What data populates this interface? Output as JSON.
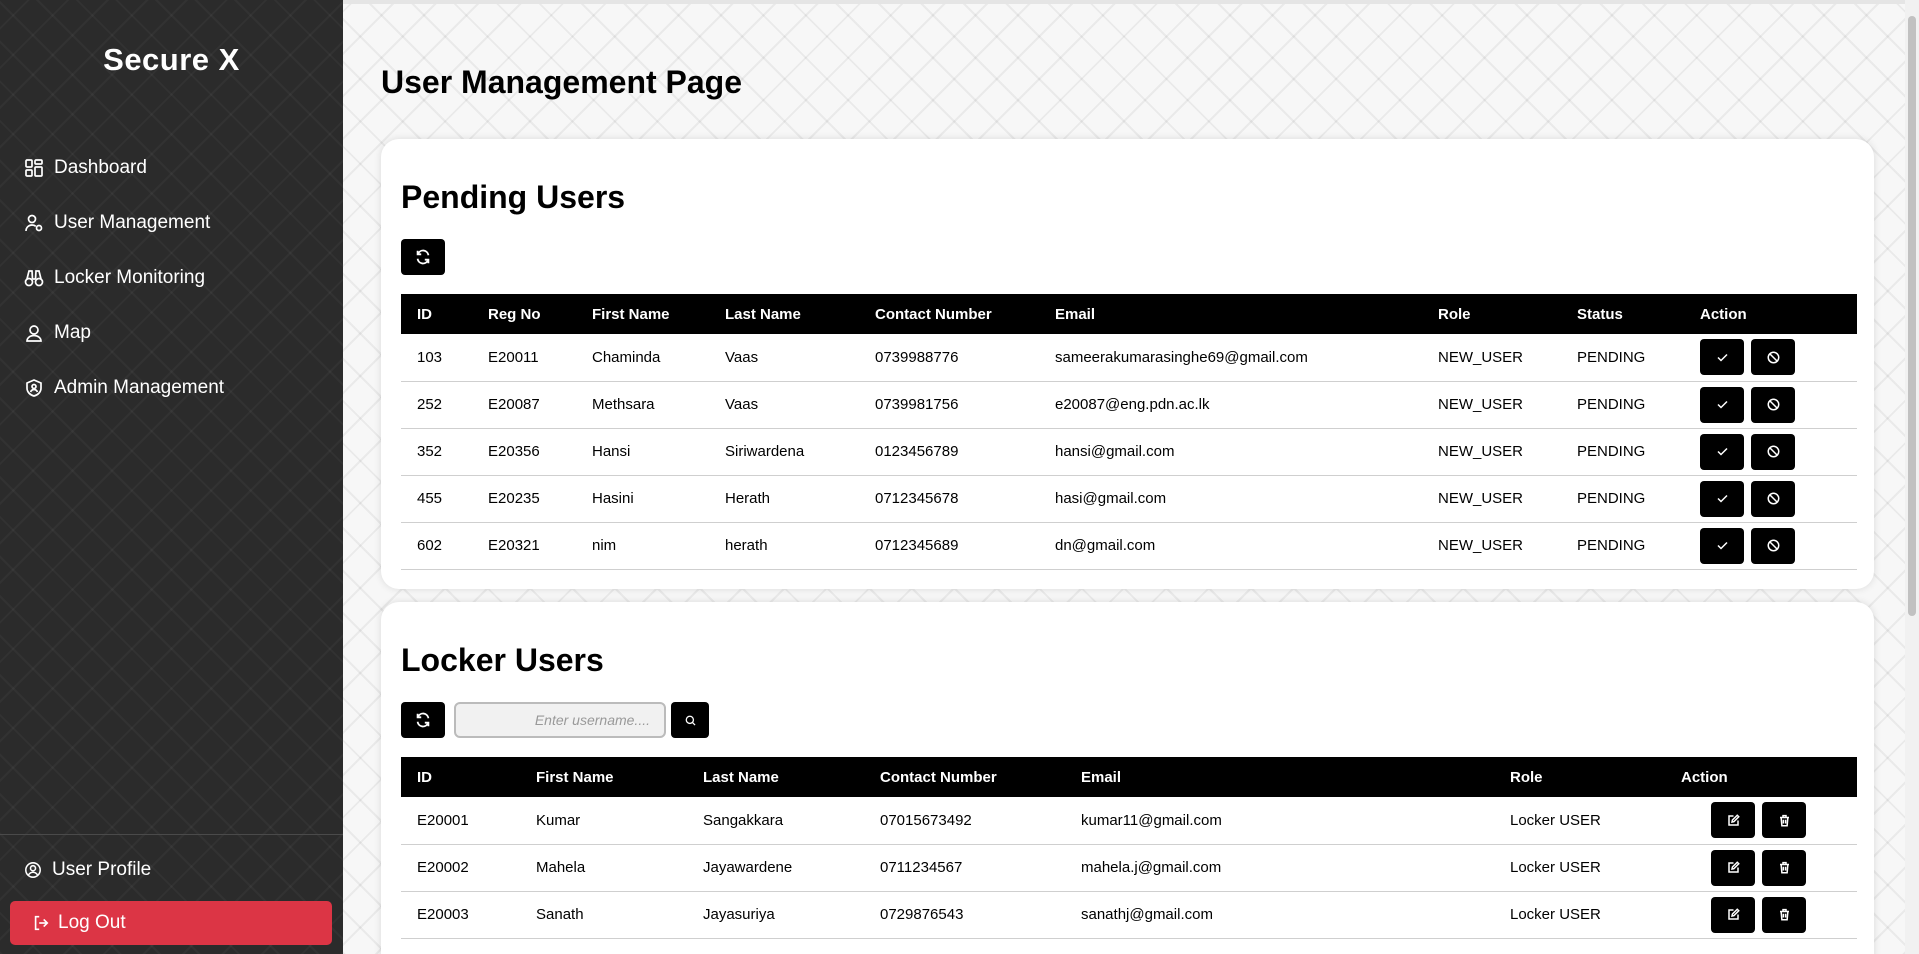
{
  "sidebar": {
    "brand": "Secure X",
    "items": [
      {
        "label": "Dashboard",
        "icon": "dashboard-icon"
      },
      {
        "label": "User Management",
        "icon": "user-management-icon"
      },
      {
        "label": "Locker Monitoring",
        "icon": "binoculars-icon"
      },
      {
        "label": "Map",
        "icon": "map-pin-icon"
      },
      {
        "label": "Admin Management",
        "icon": "shield-user-icon"
      }
    ],
    "profile": "User Profile",
    "logout": "Log Out"
  },
  "main": {
    "title": "User Management Page",
    "pending": {
      "title": "Pending Users",
      "columns": [
        "ID",
        "Reg No",
        "First Name",
        "Last Name",
        "Contact Number",
        "Email",
        "Role",
        "Status",
        "Action"
      ],
      "rows": [
        {
          "id": "103",
          "reg": "E20011",
          "first": "Chaminda",
          "last": "Vaas",
          "contact": "0739988776",
          "email": "sameerakumarasinghe69@gmail.com",
          "role": "NEW_USER",
          "status": "PENDING"
        },
        {
          "id": "252",
          "reg": "E20087",
          "first": "Methsara",
          "last": "Vaas",
          "contact": "0739981756",
          "email": "e20087@eng.pdn.ac.lk",
          "role": "NEW_USER",
          "status": "PENDING"
        },
        {
          "id": "352",
          "reg": "E20356",
          "first": "Hansi",
          "last": "Siriwardena",
          "contact": "0123456789",
          "email": "hansi@gmail.com",
          "role": "NEW_USER",
          "status": "PENDING"
        },
        {
          "id": "455",
          "reg": "E20235",
          "first": "Hasini",
          "last": "Herath",
          "contact": "0712345678",
          "email": "hasi@gmail.com",
          "role": "NEW_USER",
          "status": "PENDING"
        },
        {
          "id": "602",
          "reg": "E20321",
          "first": "nim",
          "last": "herath",
          "contact": "0712345689",
          "email": "dn@gmail.com",
          "role": "NEW_USER",
          "status": "PENDING"
        }
      ]
    },
    "locker": {
      "title": "Locker Users",
      "search_placeholder": "Enter username....",
      "columns": [
        "ID",
        "First Name",
        "Last Name",
        "Contact Number",
        "Email",
        "Role",
        "Action"
      ],
      "rows": [
        {
          "id": "E20001",
          "first": "Kumar",
          "last": "Sangakkara",
          "contact": "07015673492",
          "email": "kumar11@gmail.com",
          "role": "Locker USER"
        },
        {
          "id": "E20002",
          "first": "Mahela",
          "last": "Jayawardene",
          "contact": "0711234567",
          "email": "mahela.j@gmail.com",
          "role": "Locker USER"
        },
        {
          "id": "E20003",
          "first": "Sanath",
          "last": "Jayasuriya",
          "contact": "0729876543",
          "email": "sanathj@gmail.com",
          "role": "Locker USER"
        }
      ]
    }
  },
  "colors": {
    "sidebar_bg": "#2b2b2b",
    "logout_bg": "#dc3545",
    "table_header_bg": "#000000"
  }
}
